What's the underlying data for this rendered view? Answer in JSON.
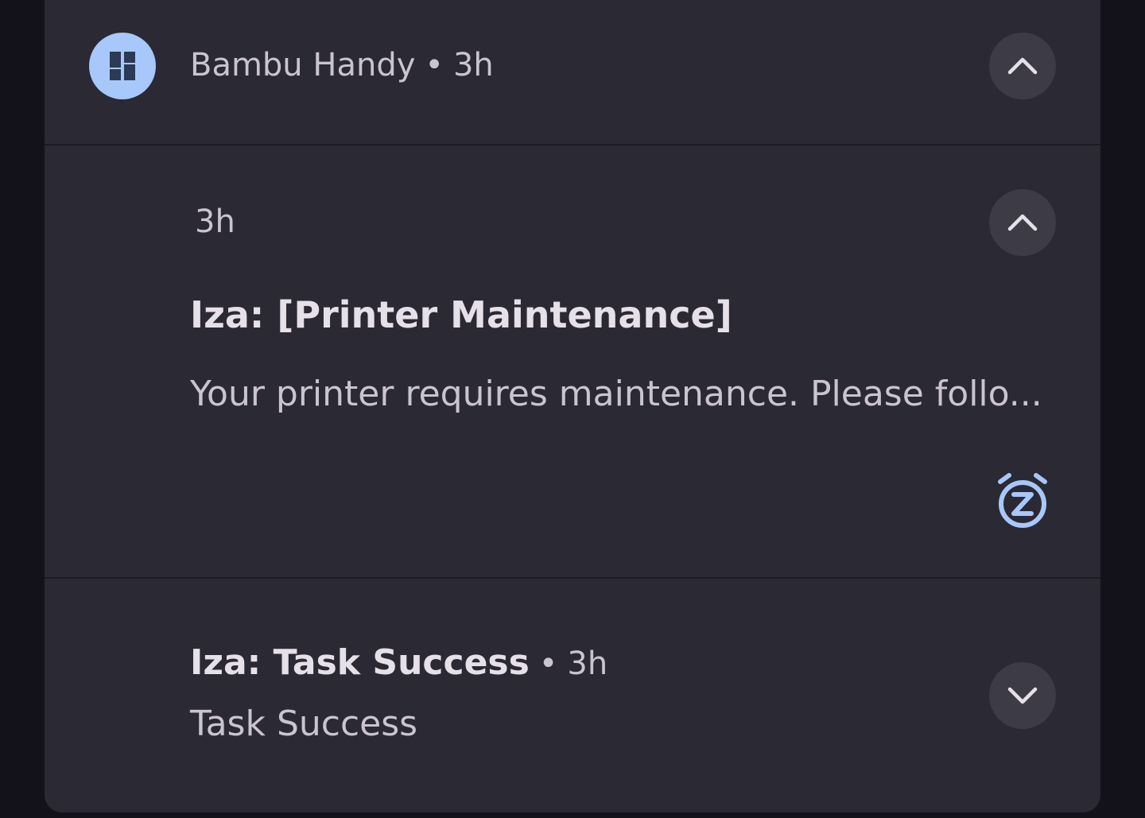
{
  "group_header": {
    "app_name": "Bambu Handy",
    "separator": "•",
    "time": "3h",
    "app_icon": "bambu-handy-logo",
    "icon_color": "#a8c7fa",
    "collapse_icon": "chevron-up-icon"
  },
  "notification_1": {
    "time": "3h",
    "title": "Iza: [Printer Maintenance]",
    "body": "Your printer requires maintenance. Please follo...",
    "collapse_icon": "chevron-up-icon",
    "snooze_icon": "snooze-icon",
    "snooze_color": "#a8c7fa"
  },
  "notification_2": {
    "title": "Iza: Task Success",
    "separator": "•",
    "time": "3h",
    "body": "Task Success",
    "expand_icon": "chevron-down-icon"
  },
  "colors": {
    "background": "#13121b",
    "panel": "#2b2934",
    "button": "#3d3b46",
    "text_primary": "#e6e0e9",
    "text_secondary": "#cac4d0",
    "accent": "#a8c7fa"
  }
}
